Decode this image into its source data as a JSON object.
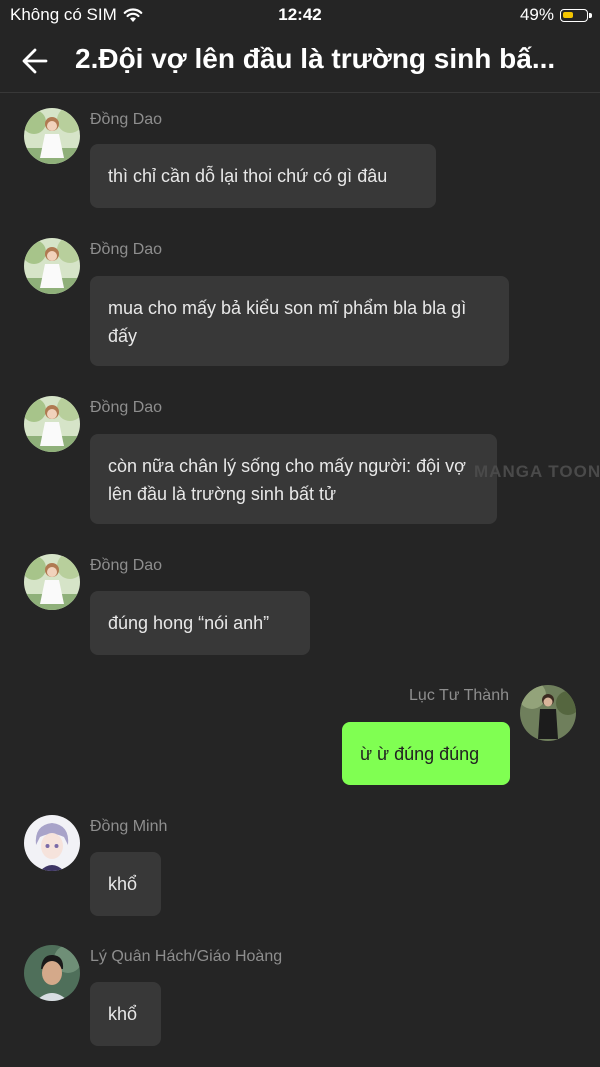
{
  "status_bar": {
    "carrier": "Không có SIM",
    "time": "12:42",
    "battery_percent": "49%",
    "battery_level": 0.49
  },
  "header": {
    "title": "2.Đội vợ lên đầu là trường sinh bấ..."
  },
  "messages": [
    {
      "sender": "Đồng Dao",
      "text": "thì chỉ cần dỗ lại thoi chứ có gì đâu",
      "side": "left",
      "avatar": "girl-white-dress-avatar"
    },
    {
      "sender": "Đồng Dao",
      "text": "mua cho mấy bả kiểu son mĩ phẩm bla bla gì đấy",
      "side": "left",
      "avatar": "girl-white-dress-avatar"
    },
    {
      "sender": "Đồng Dao",
      "text": "còn nữa chân lý sống cho mấy người: đội vợ lên đầu là trường sinh bất tử",
      "side": "left",
      "avatar": "girl-white-dress-avatar"
    },
    {
      "sender": "Đồng Dao",
      "text": "đúng hong “nói anh”",
      "side": "left",
      "avatar": "girl-white-dress-avatar"
    },
    {
      "sender": "Lục Tư Thành",
      "text": "ừ ừ đúng đúng",
      "side": "right",
      "avatar": "man-in-suit-avatar"
    },
    {
      "sender": "Đồng Minh",
      "text": "khổ",
      "side": "left",
      "avatar": "anime-boy-avatar"
    },
    {
      "sender": "Lý Quân Hách/Giáo Hoàng",
      "text": "khổ",
      "side": "left",
      "avatar": "man-portrait-avatar"
    }
  ],
  "watermark": "MANGA TOON",
  "colors": {
    "background": "#252525",
    "bubble_other": "#383838",
    "bubble_mine": "#80ff52",
    "sender_name": "#8e8e8e",
    "battery": "#f4c500"
  }
}
